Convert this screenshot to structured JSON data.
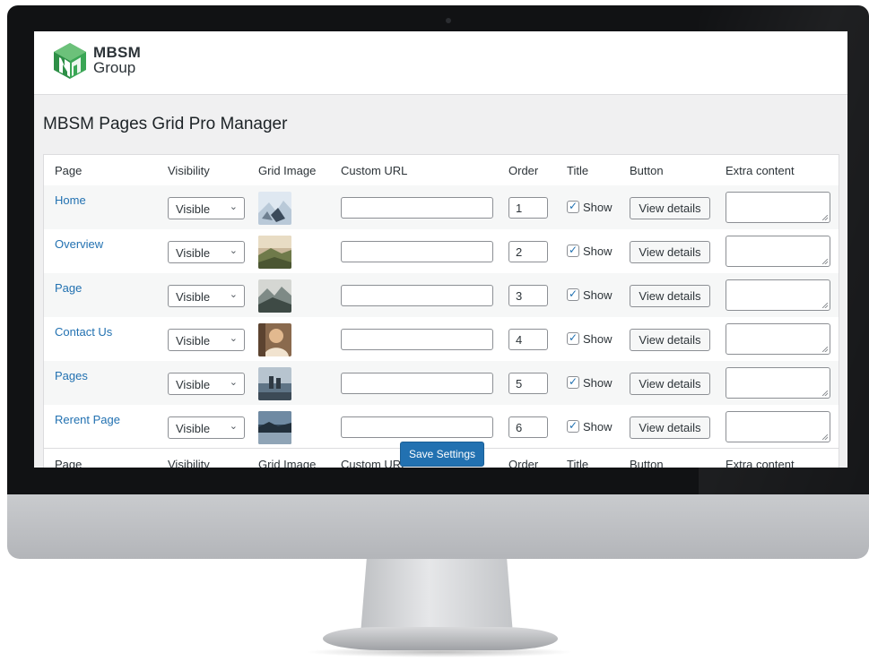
{
  "brand": {
    "line1": "MBSM",
    "line2": "Group",
    "colors": {
      "green": "#3aa655",
      "dark_green": "#1f7a3a"
    }
  },
  "page_title": "MBSM Pages Grid Pro Manager",
  "columns": [
    "Page",
    "Visibility",
    "Grid Image",
    "Custom URL",
    "Order",
    "Title",
    "Button",
    "Extra content"
  ],
  "rows": [
    {
      "page": "Home",
      "visibility": "Visible",
      "image_icon": "winter-landscape-thumbnail",
      "custom_url": "",
      "order": "1",
      "title_checked": true,
      "title_label": "Show",
      "button_label": "View details",
      "extra": ""
    },
    {
      "page": "Overview",
      "visibility": "Visible",
      "image_icon": "hills-landscape-thumbnail",
      "custom_url": "",
      "order": "2",
      "title_checked": true,
      "title_label": "Show",
      "button_label": "View details",
      "extra": ""
    },
    {
      "page": "Page",
      "visibility": "Visible",
      "image_icon": "mountain-landscape-thumbnail",
      "custom_url": "",
      "order": "3",
      "title_checked": true,
      "title_label": "Show",
      "button_label": "View details",
      "extra": ""
    },
    {
      "page": "Contact Us",
      "visibility": "Visible",
      "image_icon": "portrait-thumbnail",
      "custom_url": "",
      "order": "4",
      "title_checked": true,
      "title_label": "Show",
      "button_label": "View details",
      "extra": ""
    },
    {
      "page": "Pages",
      "visibility": "Visible",
      "image_icon": "sunset-people-thumbnail",
      "custom_url": "",
      "order": "5",
      "title_checked": true,
      "title_label": "Show",
      "button_label": "View details",
      "extra": ""
    },
    {
      "page": "Rerent Page",
      "visibility": "Visible",
      "image_icon": "lake-landscape-thumbnail",
      "custom_url": "",
      "order": "6",
      "title_checked": true,
      "title_label": "Show",
      "button_label": "View details",
      "extra": ""
    }
  ],
  "save_label": "Save Settings",
  "accent_color": "#2271b1"
}
